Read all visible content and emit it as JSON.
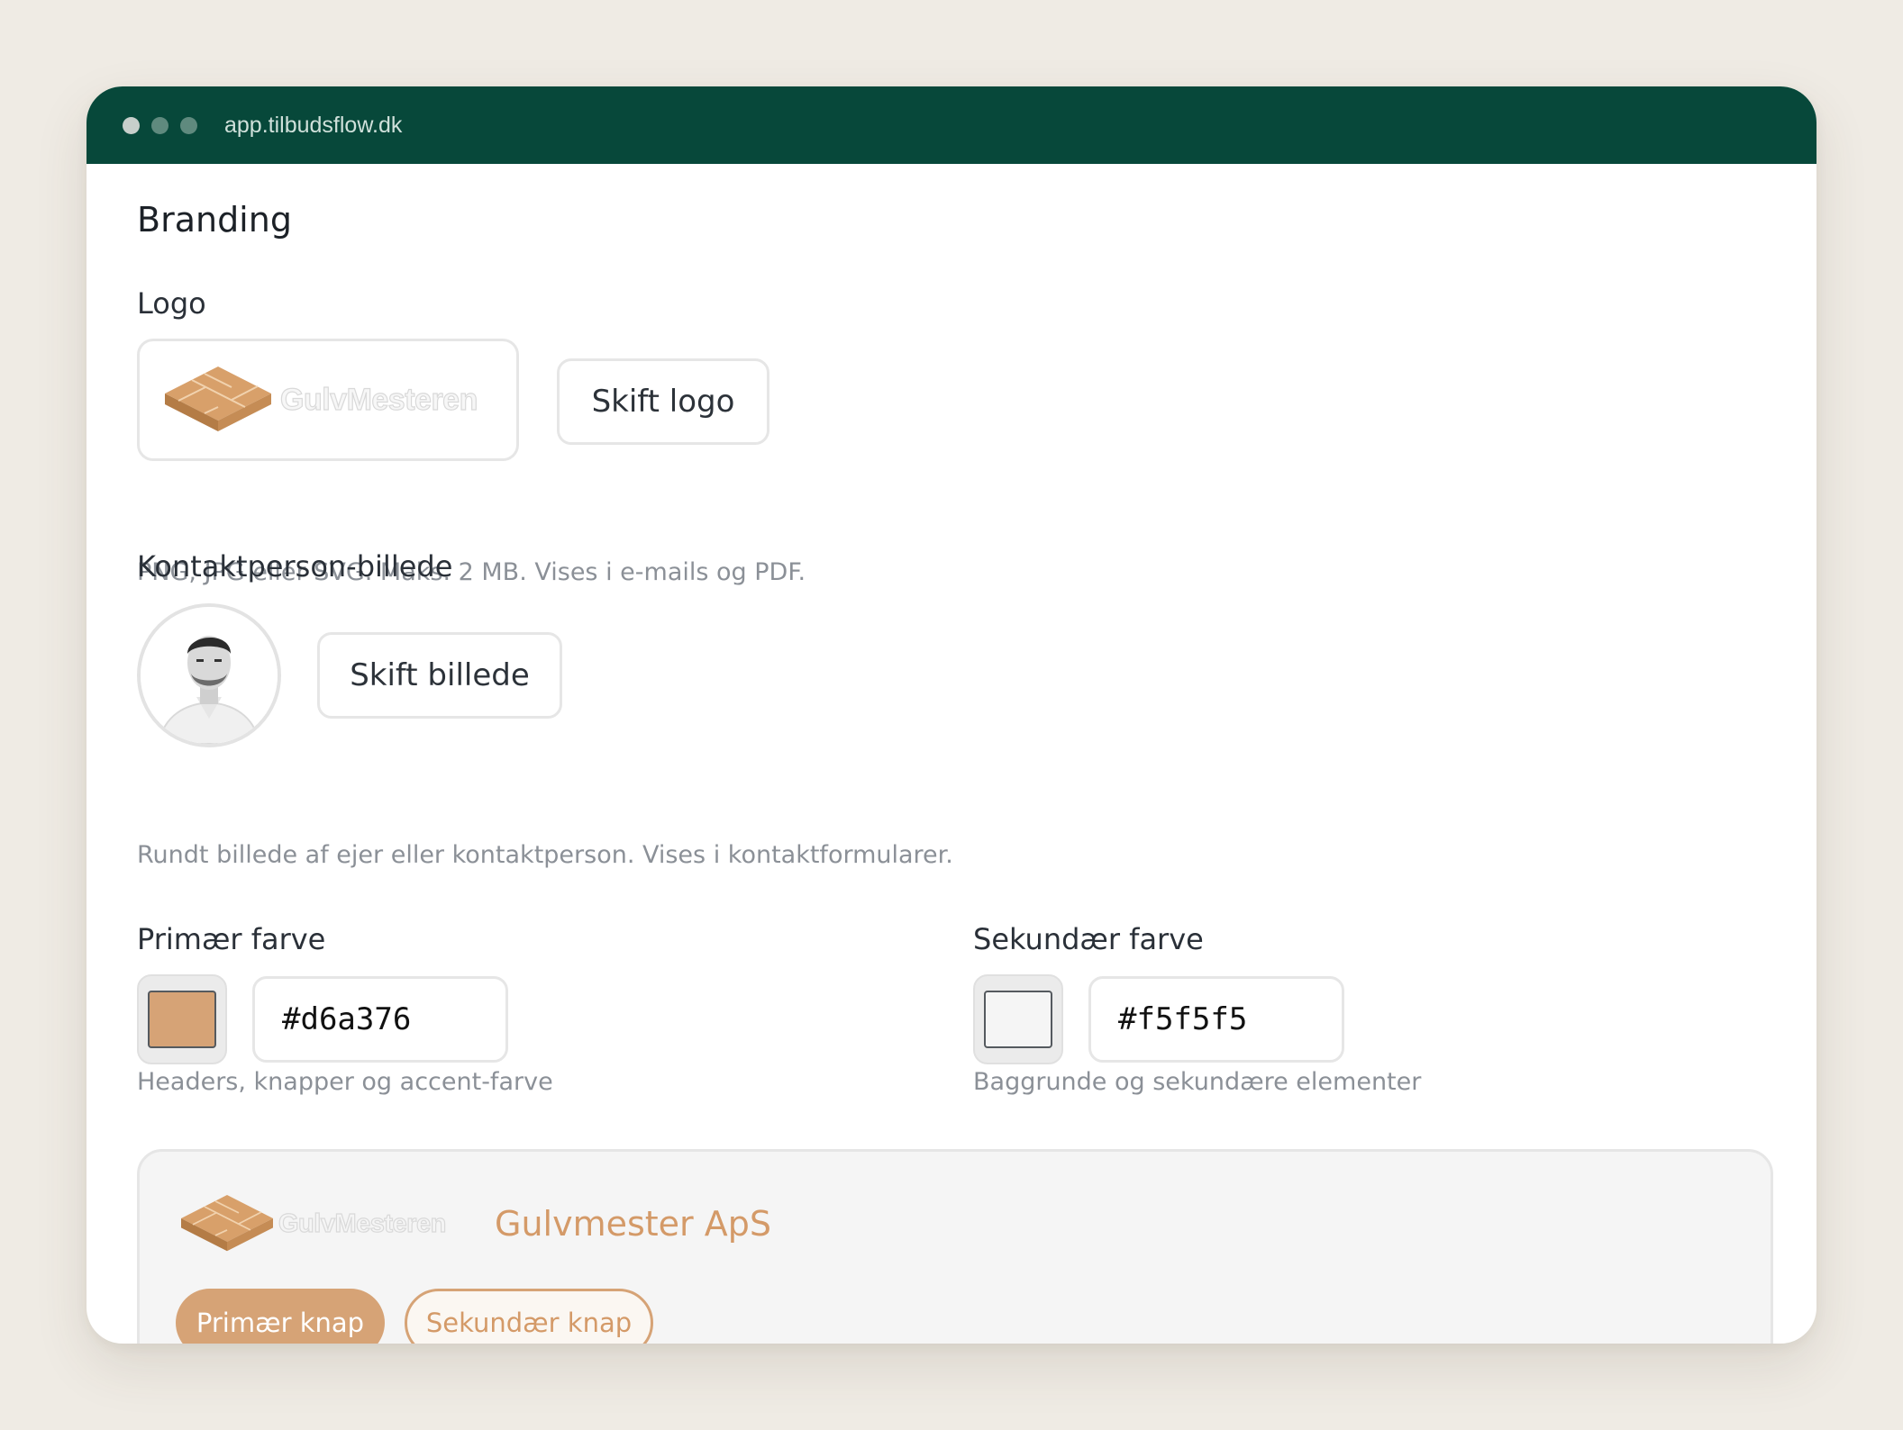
{
  "window": {
    "url": "app.tilbudsflow.dk"
  },
  "section": {
    "title": "Branding"
  },
  "logo": {
    "label": "Logo",
    "brand_text": "GulvMesteren",
    "change_button": "Skift logo",
    "help": "PNG, JPG eller SVG. Maks. 2 MB. Vises i e-mails og PDF."
  },
  "contact": {
    "label": "Kontaktperson-billede",
    "change_button": "Skift billede",
    "help": "Rundt billede af ejer eller kontaktperson. Vises i kontaktformularer."
  },
  "primary_color": {
    "label": "Primær farve",
    "value": "#d6a376",
    "help": "Headers, knapper og accent-farve"
  },
  "secondary_color": {
    "label": "Sekundær farve",
    "value": "#f5f5f5",
    "help": "Baggrunde og sekundære elementer"
  },
  "preview": {
    "brand_text": "GulvMesteren",
    "company_name": "Gulvmester ApS",
    "primary_button": "Primær knap",
    "secondary_button": "Sekundær knap"
  },
  "colors": {
    "titlebar": "#07483a",
    "accent": "#d6a376",
    "accent_text": "#d49a68",
    "page_bg": "#efebe4"
  }
}
